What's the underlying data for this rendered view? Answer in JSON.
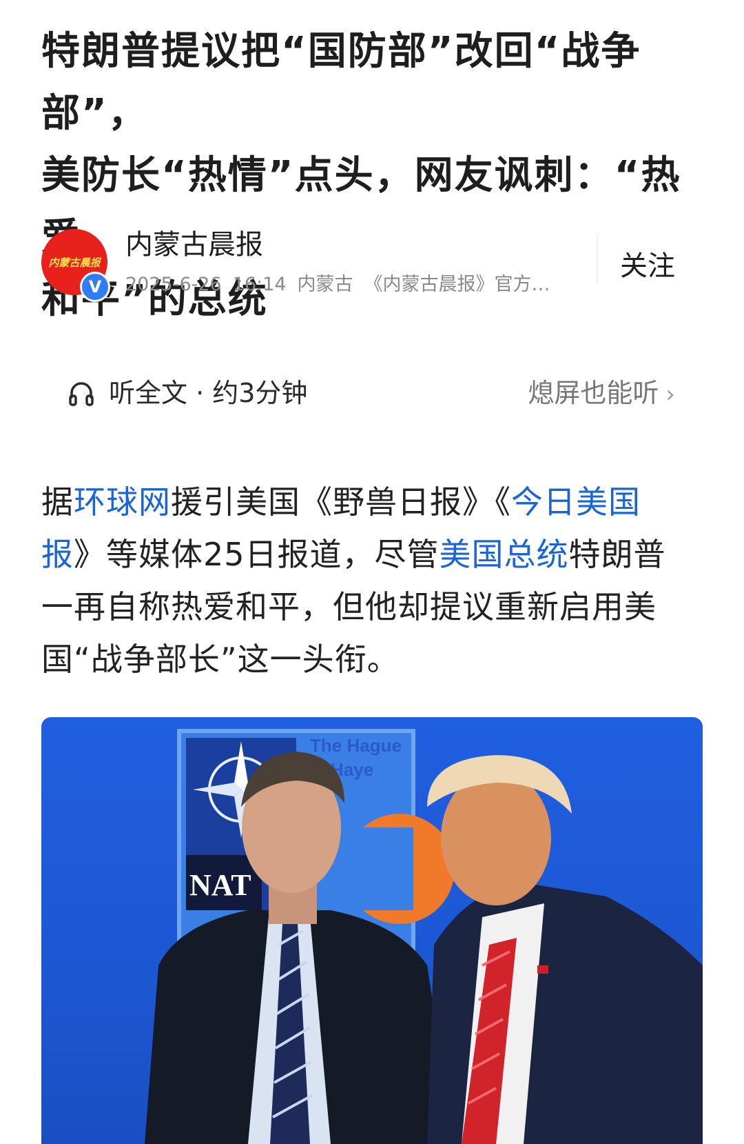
{
  "article": {
    "title_line1": "特朗普提议把“国防部”改回“战争部”，",
    "title_line2": "美防长“热情”点头，网友讽刺：“热爱",
    "title_line3": "和平”的总统",
    "author": {
      "logo_text": "内蒙古晨报",
      "verified_mark": "V",
      "name": "内蒙古晨报",
      "date": "2025-6-26",
      "time": "16:14",
      "location": "内蒙古",
      "description": "《内蒙古晨报》官方…"
    },
    "follow_label": "关注",
    "listen": {
      "label": "听全文 · 约3分钟",
      "screen_off": "熄屏也能听"
    },
    "body": {
      "p1_a": "据",
      "link_huanqiu": "环球网",
      "p1_b": "援引美国《野兽日报》《",
      "link_usatoday": "今日美国报",
      "p1_c": "》等媒体25日报道，尽管",
      "link_president": "美国总统",
      "p1_d": "特朗普一再自称热爱和平，但他却提议重新启用美国“战争部长”这一头衔。"
    },
    "photo": {
      "sign_text_1": "The Hague",
      "sign_text_2": "Haye",
      "sign_text_3": "NAT"
    }
  },
  "colors": {
    "link": "#1a64d6",
    "verified": "#2f7cf6",
    "logo_bg": "#e8211c",
    "photo_bg": "#1f5fe0"
  }
}
